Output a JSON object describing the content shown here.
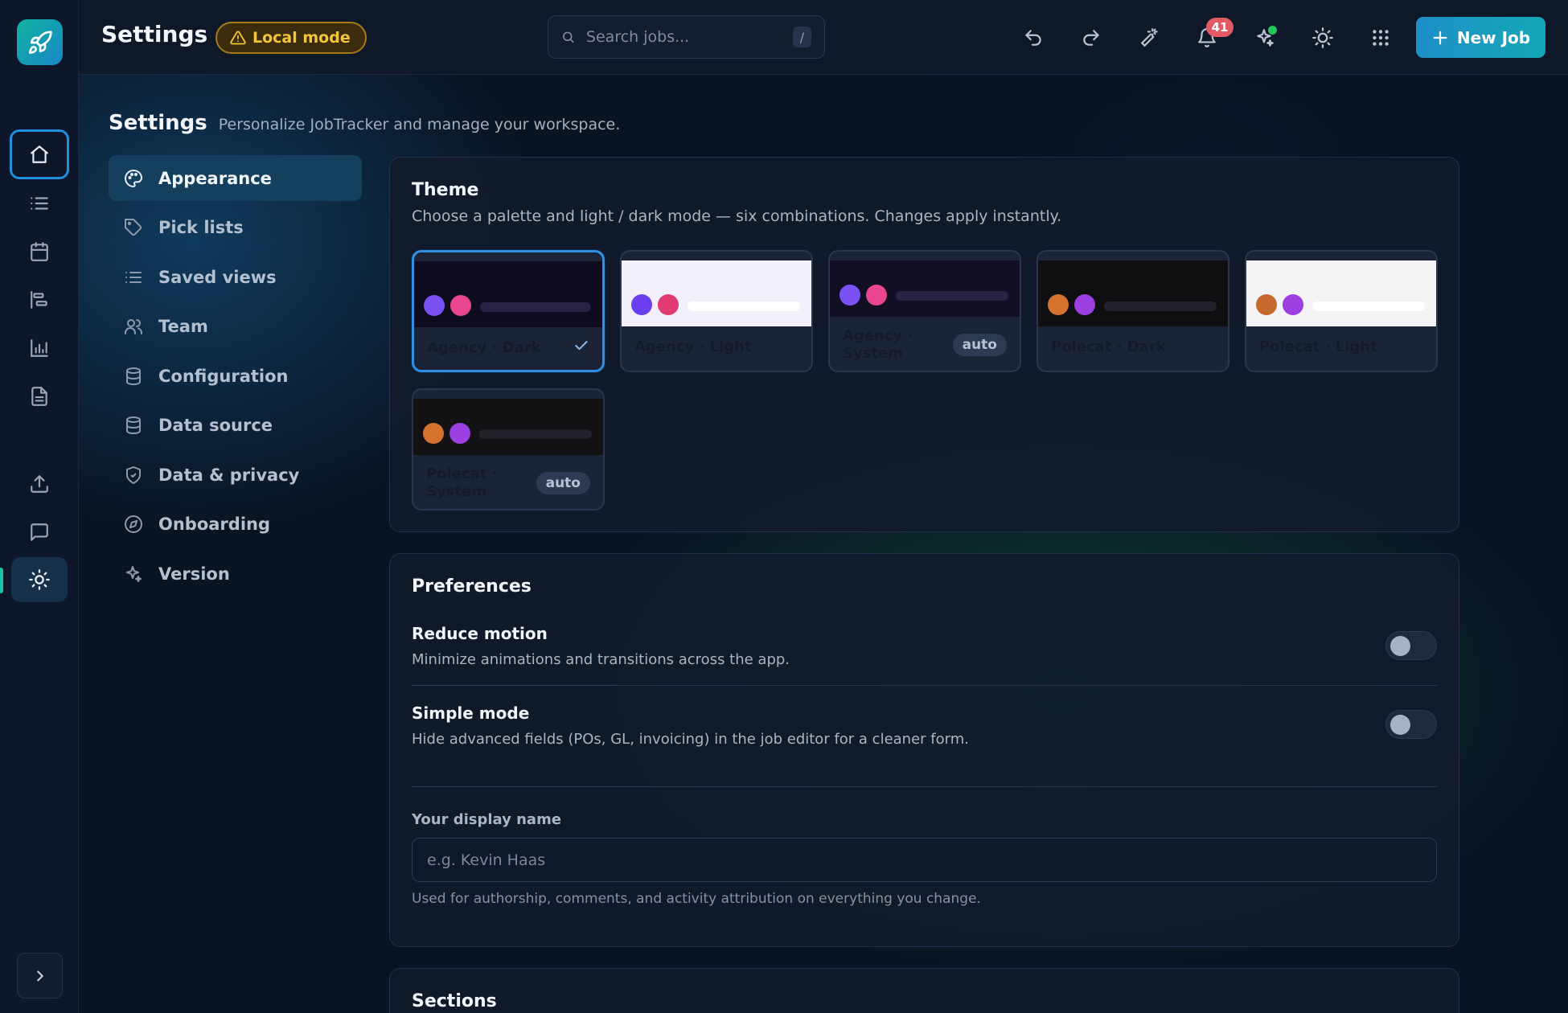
{
  "header": {
    "title": "Settings",
    "local_mode": "Local mode",
    "search_placeholder": "Search jobs...",
    "search_shortcut": "/",
    "notifications_count": "41",
    "new_job": "New Job"
  },
  "page": {
    "title": "Settings",
    "subtitle": "Personalize JobTracker and manage your workspace."
  },
  "nav": {
    "items": [
      {
        "label": "Appearance",
        "icon": "palette-icon",
        "active": true
      },
      {
        "label": "Pick lists",
        "icon": "tag-icon"
      },
      {
        "label": "Saved views",
        "icon": "list-icon"
      },
      {
        "label": "Team",
        "icon": "users-icon"
      },
      {
        "label": "Configuration",
        "icon": "database-icon"
      },
      {
        "label": "Data source",
        "icon": "database-icon"
      },
      {
        "label": "Data & privacy",
        "icon": "shield-icon"
      },
      {
        "label": "Onboarding",
        "icon": "compass-icon"
      },
      {
        "label": "Version",
        "icon": "sparkle-icon"
      }
    ]
  },
  "theme": {
    "title": "Theme",
    "description": "Choose a palette and light / dark mode — six combinations. Changes apply instantly.",
    "options": [
      {
        "label": "Agency · Dark",
        "selected": true,
        "preview_bg": "#0f0b1f",
        "dot1": "#7a52f4",
        "dot2": "#e9468d",
        "bar": "#2a2245"
      },
      {
        "label": "Agency · Light",
        "preview_bg": "#f3f0fb",
        "dot1": "#6b3ef0",
        "dot2": "#e23a72",
        "bar": "#ffffff"
      },
      {
        "label": "Agency · System",
        "auto": "auto",
        "preview_bg": "#120e24",
        "dot1": "#7a52f4",
        "dot2": "#e9468d",
        "bar": "#2a2245"
      },
      {
        "label": "Polecat · Dark",
        "preview_bg": "#0f0f12",
        "dot1": "#d4722e",
        "dot2": "#9b3fe0",
        "bar": "#22222a"
      },
      {
        "label": "Polecat · Light",
        "preview_bg": "#f4f4f7",
        "dot1": "#c56a2c",
        "dot2": "#9b3fe0",
        "bar": "#ffffff"
      },
      {
        "label": "Polecat · System",
        "auto": "auto",
        "preview_bg": "#121215",
        "dot1": "#d4722e",
        "dot2": "#9b3fe0",
        "bar": "#22222a"
      }
    ]
  },
  "preferences": {
    "title": "Preferences",
    "reduce_motion": {
      "name": "Reduce motion",
      "desc": "Minimize animations and transitions across the app."
    },
    "simple_mode": {
      "name": "Simple mode",
      "desc": "Hide advanced fields (POs, GL, invoicing) in the job editor for a cleaner form."
    },
    "display_name": {
      "label": "Your display name",
      "placeholder": "e.g. Kevin Haas",
      "help": "Used for authorship, comments, and activity attribution on everything you change."
    }
  },
  "sections": {
    "title": "Sections"
  }
}
